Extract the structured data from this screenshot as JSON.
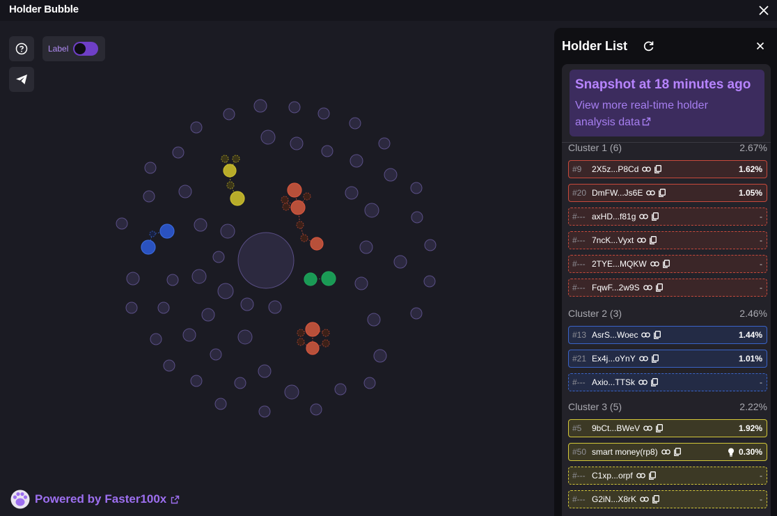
{
  "app": {
    "title": "Holder Bubble"
  },
  "toolbar": {
    "label_toggle": "Label",
    "label_on": true
  },
  "footer": {
    "powered_prefix": "Powered by",
    "brand": "Faster100x"
  },
  "colors": {
    "accent": "#9d6ff0",
    "cluster1": "#c84a3c",
    "cluster2": "#3a64c8",
    "cluster3": "#d4c83a",
    "cluster4": "#1fa05a",
    "bubble": "#3a3458"
  },
  "panel": {
    "title": "Holder List",
    "snapshot_title": "Snapshot at 18 minutes ago",
    "snapshot_link": "View more real-time holder analysis data"
  },
  "clusters": [
    {
      "name": "Cluster 1 (6)",
      "percent": "2.67%",
      "color": "red",
      "rows": [
        {
          "rank": "#9",
          "address": "2X5z...P8Cd",
          "value": "1.62%",
          "dashed": false
        },
        {
          "rank": "#20",
          "address": "DmFW...Js6E",
          "value": "1.05%",
          "dashed": false
        },
        {
          "rank": "#---",
          "address": "axHD...f81g",
          "value": "-",
          "dashed": true
        },
        {
          "rank": "#---",
          "address": "7ncK...Vyxt",
          "value": "-",
          "dashed": true
        },
        {
          "rank": "#---",
          "address": "2TYE...MQKW",
          "value": "-",
          "dashed": true
        },
        {
          "rank": "#---",
          "address": "FqwF...2w9S",
          "value": "-",
          "dashed": true
        }
      ]
    },
    {
      "name": "Cluster 2 (3)",
      "percent": "2.46%",
      "color": "blue",
      "rows": [
        {
          "rank": "#13",
          "address": "AsrS...Woec",
          "value": "1.44%",
          "dashed": false
        },
        {
          "rank": "#21",
          "address": "Ex4j...oYnY",
          "value": "1.01%",
          "dashed": false
        },
        {
          "rank": "#---",
          "address": "Axio...TTSk",
          "value": "-",
          "dashed": true
        }
      ]
    },
    {
      "name": "Cluster 3 (5)",
      "percent": "2.22%",
      "color": "yellow",
      "rows": [
        {
          "rank": "#5",
          "address": "9bCt...BWeV",
          "value": "1.92%",
          "dashed": false
        },
        {
          "rank": "#50",
          "address": "smart money(rp8)",
          "value": "0.30%",
          "dashed": false,
          "bulb": true
        },
        {
          "rank": "#---",
          "address": "C1xp...orpf",
          "value": "-",
          "dashed": true
        },
        {
          "rank": "#---",
          "address": "G2iN...X8rK",
          "value": "-",
          "dashed": true
        }
      ]
    }
  ]
}
